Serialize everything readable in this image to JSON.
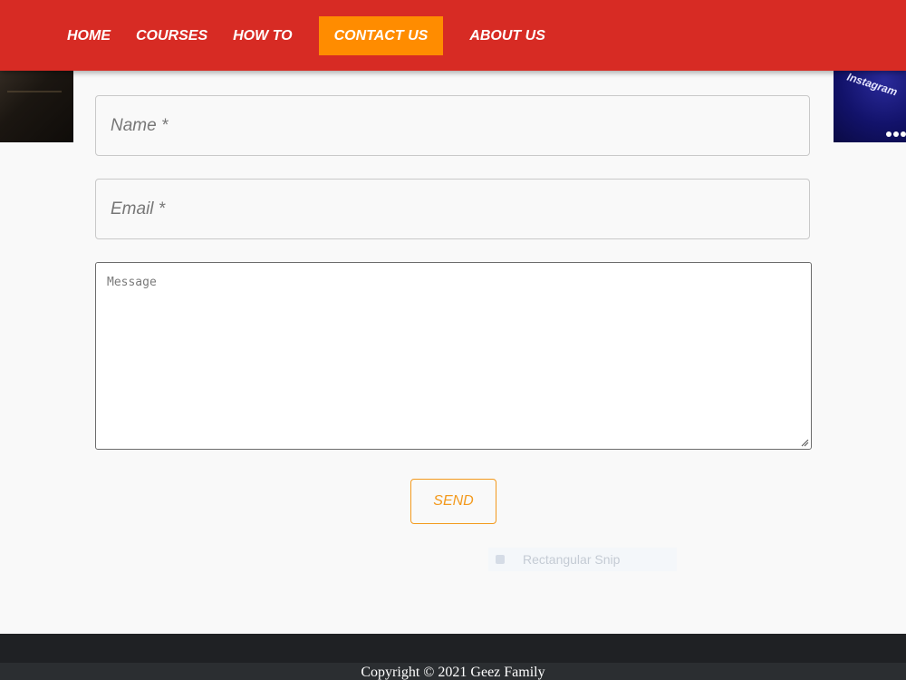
{
  "nav": {
    "items": [
      {
        "label": "HOME",
        "active": false
      },
      {
        "label": "COURSES",
        "active": false
      },
      {
        "label": "HOW TO",
        "active": false
      },
      {
        "label": "CONTACT US",
        "active": true
      },
      {
        "label": "ABOUT US",
        "active": false
      }
    ],
    "colors": {
      "header_bg": "#d72b24",
      "active_bg": "#ff8c00",
      "text": "#ffffff"
    }
  },
  "side_images": {
    "right_label": "Instagram"
  },
  "form": {
    "name_placeholder": "Name *",
    "name_value": "",
    "email_placeholder": "Email *",
    "email_value": "",
    "message_placeholder": "Message",
    "message_value": "",
    "send_label": "SEND",
    "accent_color": "#f39a1e"
  },
  "overlay": {
    "snip_label": "Rectangular Snip"
  },
  "footer": {
    "copyright": "Copyright © 2021 Geez Family"
  }
}
